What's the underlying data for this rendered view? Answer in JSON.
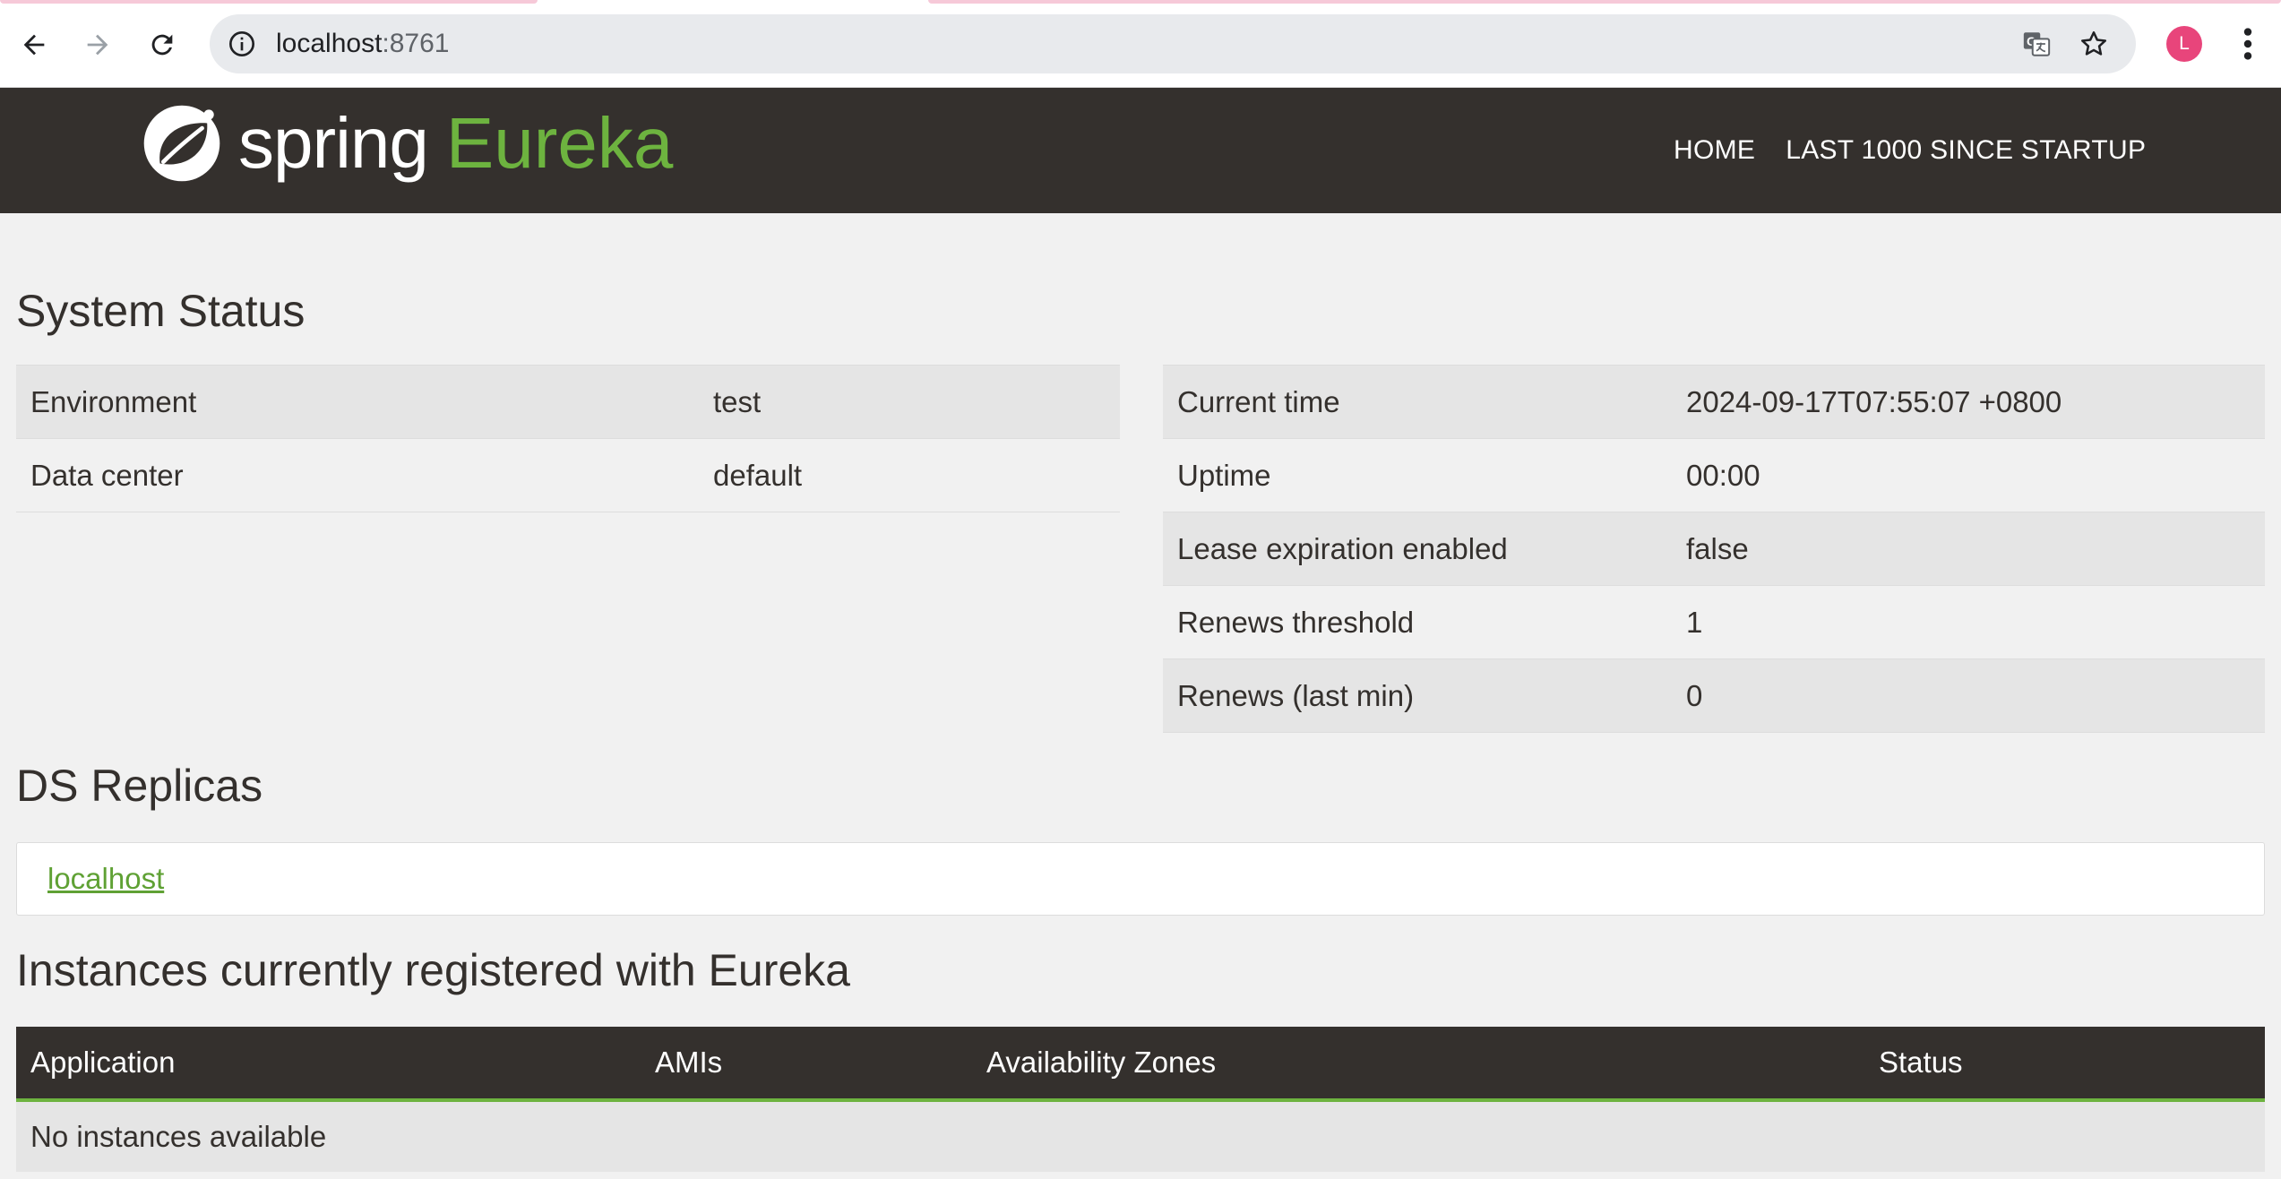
{
  "browser": {
    "url_host": "localhost",
    "url_port": ":8761",
    "profile_initial": "L"
  },
  "navbar": {
    "brand_spring": "spring",
    "brand_eureka": "Eureka",
    "links": [
      "HOME",
      "LAST 1000 SINCE STARTUP"
    ]
  },
  "system_status": {
    "title": "System Status",
    "left": [
      {
        "label": "Environment",
        "value": "test"
      },
      {
        "label": "Data center",
        "value": "default"
      }
    ],
    "right": [
      {
        "label": "Current time",
        "value": "2024-09-17T07:55:07 +0800"
      },
      {
        "label": "Uptime",
        "value": "00:00"
      },
      {
        "label": "Lease expiration enabled",
        "value": "false"
      },
      {
        "label": "Renews threshold",
        "value": "1"
      },
      {
        "label": "Renews (last min)",
        "value": "0"
      }
    ]
  },
  "ds_replicas": {
    "title": "DS Replicas",
    "link": "localhost"
  },
  "instances": {
    "title": "Instances currently registered with Eureka",
    "columns": [
      "Application",
      "AMIs",
      "Availability Zones",
      "Status"
    ],
    "empty_message": "No instances available"
  },
  "colors": {
    "navbar_bg": "#34302d",
    "brand_green": "#6db33f",
    "page_bg": "#f1f1f1"
  }
}
